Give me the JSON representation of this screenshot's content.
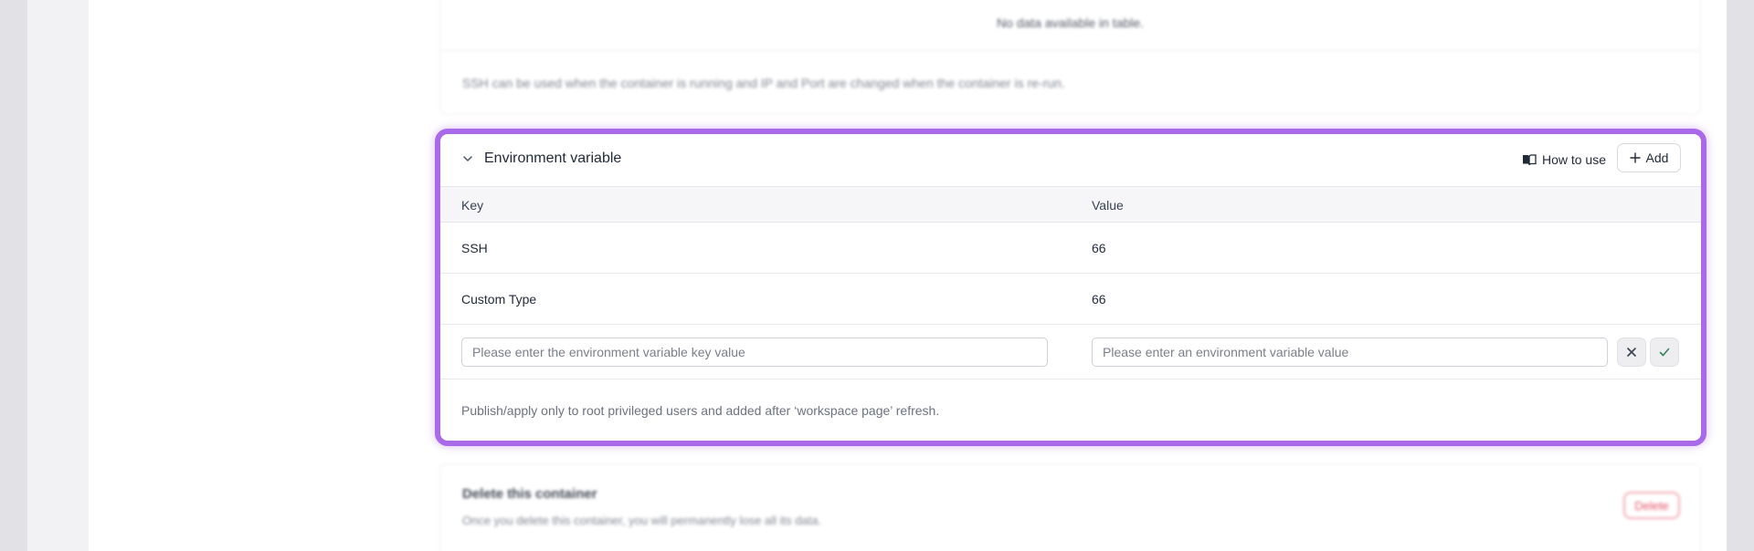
{
  "ssh_section": {
    "empty_text": "No data available in table.",
    "note": "SSH can be used when the container is running and IP and Port are changed when the container is re-run."
  },
  "env_section": {
    "title": "Environment variable",
    "how_to_use_label": "How to use",
    "add_label": "Add",
    "columns": {
      "key": "Key",
      "value": "Value"
    },
    "rows": [
      {
        "key": "SSH",
        "value": "66"
      },
      {
        "key": "Custom Type",
        "value": "66"
      }
    ],
    "key_input": {
      "value": "",
      "placeholder": "Please enter the environment variable key value"
    },
    "value_input": {
      "value": "",
      "placeholder": "Please enter an environment variable value"
    },
    "footnote": "Publish/apply only to root privileged users and added after ‘workspace page’ refresh.",
    "accent_color": "#a86ae8"
  },
  "delete_section": {
    "title": "Delete this container",
    "description": "Once you delete this container, you will permanently lose all its data.",
    "delete_label": "Delete",
    "danger_color": "#e0384d"
  },
  "icons": {
    "collapse": "chevron-down-icon",
    "how_to_use": "book-open-icon",
    "add": "plus-icon",
    "cancel": "close-icon",
    "confirm": "check-icon"
  }
}
